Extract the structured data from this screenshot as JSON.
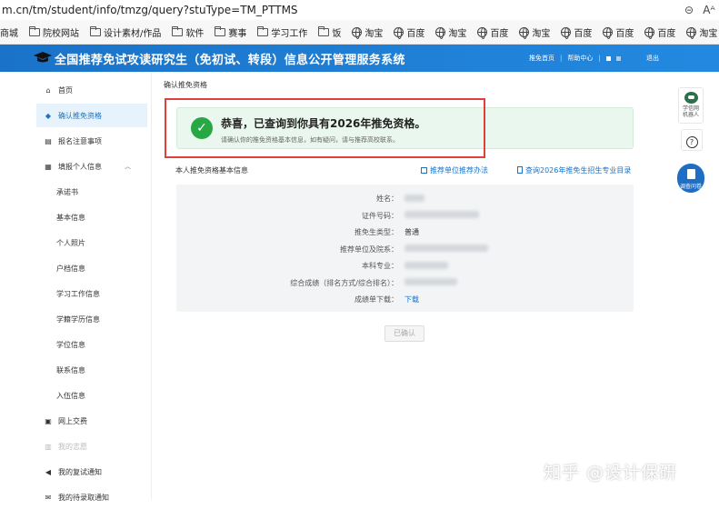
{
  "browser": {
    "url": "m.cn/tm/student/info/tmzg/query?stuType=TM_PTTMS",
    "zoom_icon": "zoom-out-icon",
    "read_aloud_icon": "read-aloud-icon",
    "read_aloud_glyph": "Aᴬ",
    "zoom_glyph": "⊝",
    "bookmarks": [
      {
        "label": "商城",
        "icon": ""
      },
      {
        "label": "院校网站",
        "icon": "folder"
      },
      {
        "label": "设计素材/作品",
        "icon": "folder"
      },
      {
        "label": "软件",
        "icon": "folder"
      },
      {
        "label": "赛事",
        "icon": "folder"
      },
      {
        "label": "学习工作",
        "icon": "folder"
      },
      {
        "label": "饭",
        "icon": "folder"
      },
      {
        "label": "淘宝",
        "icon": "globe"
      },
      {
        "label": "百度",
        "icon": "globe"
      },
      {
        "label": "淘宝",
        "icon": "globe"
      },
      {
        "label": "百度",
        "icon": "globe"
      },
      {
        "label": "淘宝",
        "icon": "globe"
      },
      {
        "label": "百度",
        "icon": "globe"
      },
      {
        "label": "百度",
        "icon": "globe"
      },
      {
        "label": "百度",
        "icon": "globe"
      },
      {
        "label": "淘宝",
        "icon": "globe"
      },
      {
        "label": "百",
        "icon": "globe"
      }
    ]
  },
  "header": {
    "title": "全国推荐免试攻读研究生（免初试、转段）信息公开管理服务系统",
    "home": "推免首页",
    "help": "帮助中心",
    "logout": "退出"
  },
  "sidebar": {
    "items": [
      {
        "label": "首页",
        "icon": "home-icon",
        "glyph": "⌂",
        "type": "top"
      },
      {
        "label": "确认推免资格",
        "icon": "shield-icon",
        "glyph": "◆",
        "type": "active"
      },
      {
        "label": "报名注意事项",
        "icon": "list-icon",
        "glyph": "▤",
        "type": "top"
      },
      {
        "label": "填报个人信息",
        "icon": "form-icon",
        "glyph": "▦",
        "type": "top",
        "expanded": true
      },
      {
        "label": "承诺书",
        "type": "sub"
      },
      {
        "label": "基本信息",
        "type": "sub"
      },
      {
        "label": "个人照片",
        "type": "sub"
      },
      {
        "label": "户档信息",
        "type": "sub"
      },
      {
        "label": "学习工作信息",
        "type": "sub"
      },
      {
        "label": "学籍学历信息",
        "type": "sub"
      },
      {
        "label": "学位信息",
        "type": "sub"
      },
      {
        "label": "联系信息",
        "type": "sub"
      },
      {
        "label": "入伍信息",
        "type": "sub"
      },
      {
        "label": "网上交费",
        "icon": "payment-icon",
        "glyph": "▣",
        "type": "top"
      },
      {
        "label": "我的志愿",
        "icon": "wish-icon",
        "glyph": "▥",
        "type": "disabled"
      },
      {
        "label": "我的复试通知",
        "icon": "speaker-icon",
        "glyph": "◀",
        "type": "top"
      },
      {
        "label": "我的待录取通知",
        "icon": "mail-icon",
        "glyph": "✉",
        "type": "top"
      }
    ],
    "expand_glyph": "︿"
  },
  "main": {
    "breadcrumb": "确认推免资格",
    "success_title": "恭喜，已查询到你具有2026年推免资格。",
    "success_subtitle": "请确认你的推免资格基本信息，如有疑问，请与推荐高校联系。",
    "section_title": "本人推免资格基本信息",
    "link_method": "推荐单位推荐办法",
    "link_catalog": "查询2026年推免生招生专业目录",
    "fields": [
      {
        "label": "姓名：",
        "value": "",
        "blur": 22
      },
      {
        "label": "证件号码：",
        "value": "",
        "blur": 82
      },
      {
        "label": "推免生类型：",
        "value": "普通",
        "blur": 0
      },
      {
        "label": "推荐单位及院系：",
        "value": "",
        "blur": 92
      },
      {
        "label": "本科专业：",
        "value": "",
        "blur": 48
      },
      {
        "label": "综合成绩（排名方式/综合排名）：",
        "value": "",
        "blur": 58
      },
      {
        "label": "成绩单下载：",
        "value": "下载",
        "blur": 0,
        "link": true
      }
    ],
    "confirm_button": "已确认"
  },
  "floating": {
    "robot_label": "学信网机器人",
    "help_glyph": "?",
    "survey_label": "调查问卷"
  },
  "watermark": "知乎 @设计保研"
}
